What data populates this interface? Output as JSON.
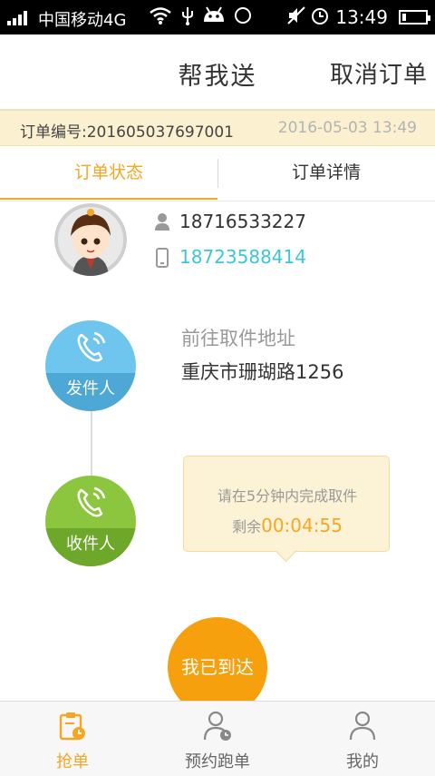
{
  "status_bar": {
    "carrier": "中国移动4G",
    "time": "13:49",
    "battery_level": 0.15,
    "icons": [
      "signal-icon",
      "wifi-icon",
      "usb-icon",
      "android-icon",
      "sync-icon",
      "mute-icon",
      "alarm-icon",
      "battery-icon"
    ]
  },
  "header": {
    "title": "帮我送",
    "action_label": "取消订单"
  },
  "order": {
    "number_label": "订单编号:",
    "number": "201605037697001",
    "datetime": "2016-05-03 13:49"
  },
  "tabs": [
    {
      "label": "订单状态",
      "active": true
    },
    {
      "label": "订单详情",
      "active": false
    }
  ],
  "courier": {
    "phone": "18716533227",
    "mobile": "18723588414"
  },
  "timeline": {
    "sender_label": "发件人",
    "receiver_label": "收件人",
    "address_label": "前往取件地址",
    "address": "重庆市珊瑚路1256"
  },
  "tip": {
    "message": "请在5分钟内完成取件",
    "remaining_label": "剩余",
    "countdown": "00:04:55"
  },
  "arrive_button": "我已到达",
  "colors": {
    "accent": "#f5a623",
    "sender": "#6ec5ee",
    "receiver": "#8cc63e",
    "mobile_text": "#3cc6d6"
  },
  "bottom_nav": [
    {
      "label": "抢单",
      "icon": "clipboard-clock-icon",
      "active": true
    },
    {
      "label": "预约跑单",
      "icon": "person-clock-icon",
      "active": false
    },
    {
      "label": "我的",
      "icon": "person-icon",
      "active": false
    }
  ]
}
